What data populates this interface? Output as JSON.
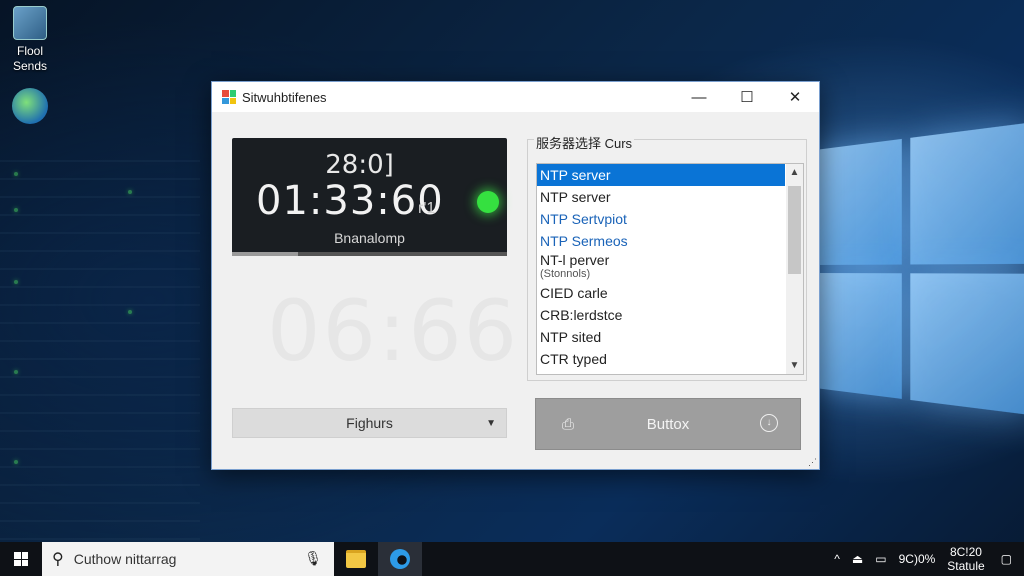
{
  "desktop": {
    "icons": [
      {
        "label_line1": "Flool",
        "label_line2": "Sends"
      }
    ]
  },
  "window": {
    "title": "Sitwuhbtifenes",
    "controls": {
      "minimize": "—",
      "maximize": "☐",
      "close": "✕"
    },
    "clock": {
      "top_time": "28:0]",
      "main_time": "01:33:60",
      "main_suffix": "r'1",
      "label": "Bnanalomp",
      "status_color": "#35e040",
      "progress_fraction": 0.24
    },
    "ghost_time": "06:66",
    "dropdown": {
      "value": "Fighurs",
      "arrow": "▼"
    },
    "server_group": {
      "legend": "服务器选择 Curs",
      "items": [
        {
          "label": "NTP server",
          "style": "selected"
        },
        {
          "label": "NTP server",
          "style": "normal"
        },
        {
          "label": "NTP Sertvpiot",
          "style": "blue"
        },
        {
          "label": "NTP Sermeos",
          "style": "blue"
        },
        {
          "label": "NT-l perver",
          "style": "normal"
        },
        {
          "label": "(Stonnols)",
          "style": "small"
        },
        {
          "label": "CIED carle",
          "style": "normal"
        },
        {
          "label": "CRB:lerdstce",
          "style": "normal"
        },
        {
          "label": "NTP sited",
          "style": "normal"
        },
        {
          "label": "CTR typed",
          "style": "normal"
        }
      ],
      "scroll_up": "▲",
      "scroll_down": "▼"
    },
    "action_button": {
      "label": "Buttox",
      "left_icon": "⎙",
      "right_icon": "↓"
    }
  },
  "taskbar": {
    "search_placeholder": "Cuthow nittarrag",
    "search_icon": "⚲",
    "mic_icon": "🎙",
    "tray": {
      "chevron": "^",
      "battery_text": "9C)0%",
      "time": "8C!20",
      "date": "Statule"
    }
  },
  "colors": {
    "selection": "#0a74d6",
    "link_blue": "#1a63b8",
    "button_gray": "#9e9e9e"
  }
}
